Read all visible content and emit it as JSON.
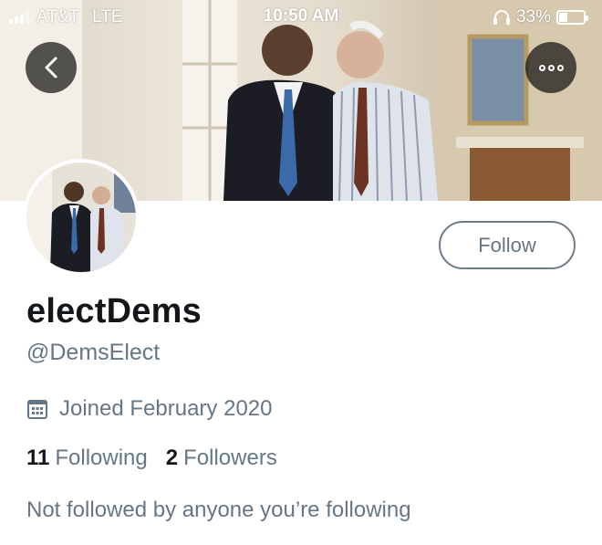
{
  "status_bar": {
    "carrier": "AT&T",
    "network": "LTE",
    "time": "10:50 AM",
    "battery_percent": "33%",
    "battery_level": 0.33,
    "signal_icon": "signal-bars-icon",
    "headset_icon": "headphones-icon"
  },
  "nav": {
    "back_icon": "chevron-left-icon",
    "more_icon": "more-options-icon"
  },
  "profile": {
    "display_name": "electDems",
    "handle": "@DemsElect",
    "joined": "Joined February 2020",
    "joined_icon": "calendar-icon",
    "following_count": "11",
    "following_label": "Following",
    "followers_count": "2",
    "followers_label": "Followers",
    "mutuals_text": "Not followed by anyone you’re following"
  },
  "actions": {
    "follow_label": "Follow"
  },
  "colors": {
    "primary_text": "#14171a",
    "secondary_text": "#657786",
    "button_border": "#6e7c8a"
  }
}
